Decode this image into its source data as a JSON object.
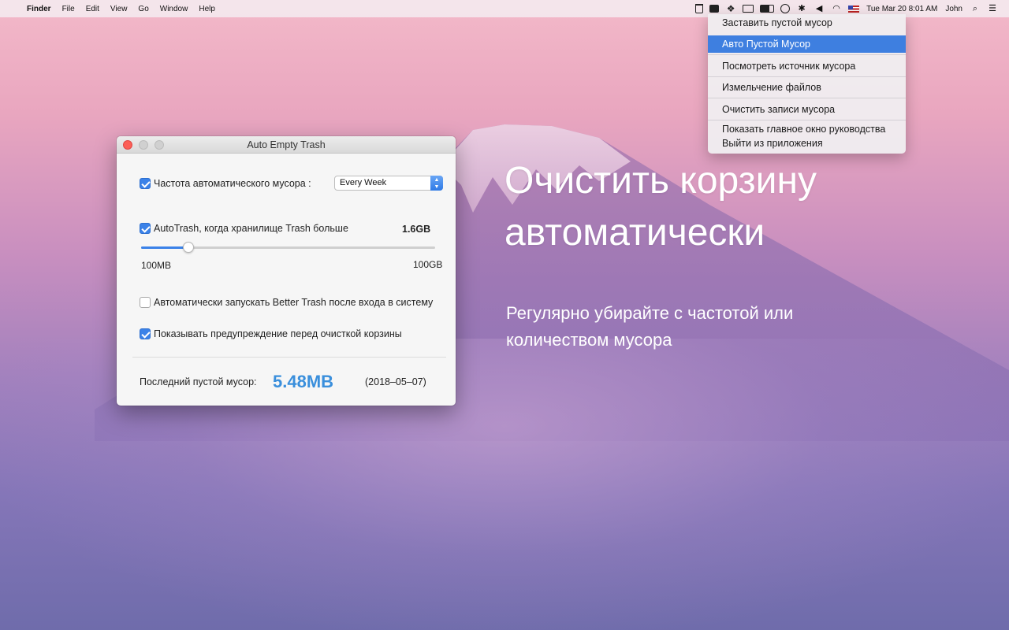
{
  "menubar": {
    "app_name": "Finder",
    "menus": [
      "File",
      "Edit",
      "View",
      "Go",
      "Window",
      "Help"
    ],
    "clock": "Tue Mar 20  8:01 AM",
    "user": "John",
    "status_icons": [
      "trash-icon",
      "box-icon",
      "dropbox-icon",
      "screen-icon",
      "battery-icon",
      "time-machine-icon",
      "bluetooth-icon",
      "volume-icon",
      "wifi-icon",
      "flag-icon"
    ]
  },
  "dropdown": {
    "items": [
      "Заставить пустой мусор",
      "Авто Пустой Мусор",
      "Посмотреть источник мусора",
      "Измельчение файлов",
      "Очистить записи мусора",
      "Показать главное окно руководства",
      "Выйти из приложения"
    ],
    "active_index": 1
  },
  "window": {
    "title": "Auto Empty Trash",
    "frequency": {
      "label": "Частота автоматического мусора :",
      "checked": true,
      "selected": "Every Week"
    },
    "autotrash": {
      "label": "AutoTrash, когда хранилище Trash больше",
      "checked": true,
      "value": "1.6GB",
      "slider_min": "100MB",
      "slider_max": "100GB",
      "slider_fraction": 0.16
    },
    "autostart": {
      "label": "Автоматически запускать Better Trash после входа в систему",
      "checked": false
    },
    "warning": {
      "label": "Показывать предупреждение перед очисткой корзины",
      "checked": true
    },
    "last": {
      "label": "Последний пустой мусор:",
      "value": "5.48MB",
      "date": "(2018–05–07)"
    }
  },
  "hero": {
    "line1": "Очистить корзину",
    "line2": "автоматически",
    "sub1": "Регулярно убирайте с частотой или",
    "sub2": "количеством мусора"
  },
  "colors": {
    "accent": "#3b82e8",
    "value_blue": "#3a8fdc",
    "menu_highlight": "#3e7fe0"
  }
}
